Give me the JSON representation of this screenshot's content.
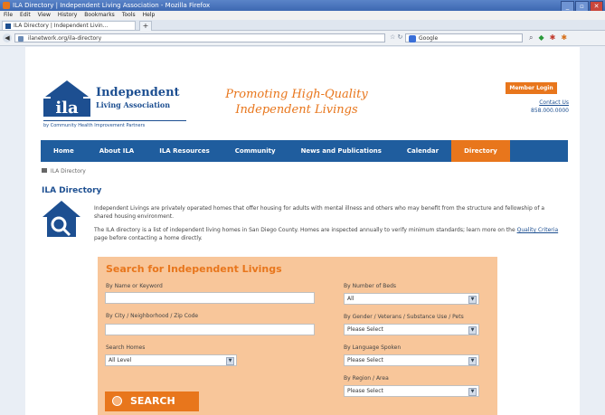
{
  "browser": {
    "title": "ILA Directory | Independent Living Association - Mozilla Firefox",
    "menu": [
      "File",
      "Edit",
      "View",
      "History",
      "Bookmarks",
      "Tools",
      "Help"
    ],
    "tab_label": "ILA Directory | Independent Livin...",
    "newtab": "+",
    "url": "ilanetwork.org/ila-directory",
    "search_placeholder": "Google",
    "back": "◀"
  },
  "header": {
    "logo_letters": "ila",
    "org_name_1": "Independent",
    "org_name_2": "Living Association",
    "org_sub": "by Community Health Improvement Partners",
    "tagline_1": "Promoting High-Quality",
    "tagline_2": "Independent Livings",
    "member_login": "Member Login",
    "contact_link": "Contact Us",
    "phone": "858.000.0000"
  },
  "nav": [
    {
      "label": "Home",
      "active": false
    },
    {
      "label": "About ILA",
      "active": false
    },
    {
      "label": "ILA Resources",
      "active": false
    },
    {
      "label": "Community",
      "active": false
    },
    {
      "label": "News and Publications",
      "active": false
    },
    {
      "label": "Calendar",
      "active": false
    },
    {
      "label": "Directory",
      "active": true
    }
  ],
  "breadcrumb": "ILA Directory",
  "page_title": "ILA Directory",
  "intro": {
    "p1": "Independent Livings are privately operated homes that offer housing for adults with mental illness and others who may benefit from the structure and fellowship of a shared housing environment.",
    "p2_before": "The ILA directory is a list of independent living homes in San Diego County. Homes are inspected annually to verify minimum standards; learn more on the",
    "p2_link": "Quality Criteria",
    "p2_after": "page before contacting a home directly."
  },
  "search": {
    "title": "Search for Independent Livings",
    "name_label": "By Name or Keyword",
    "name_value": "",
    "city_label": "By City / Neighborhood / Zip Code",
    "city_value": "",
    "type_label": "Search Homes",
    "type_value": "All Level",
    "beds_label": "By Number of Beds",
    "beds_value": "All",
    "gender_label": "By Gender / Veterans / Substance Use / Pets",
    "gender_value": "Please Select",
    "lang_label": "By Language Spoken",
    "lang_value": "Please Select",
    "area_label": "By Region / Area",
    "area_value": "Please Select",
    "button_label": "SEARCH"
  },
  "colors": {
    "brand_blue": "#1d4f91",
    "nav_blue": "#1f5d9e",
    "accent_orange": "#e8761c",
    "panel_orange": "#f8c69a"
  }
}
